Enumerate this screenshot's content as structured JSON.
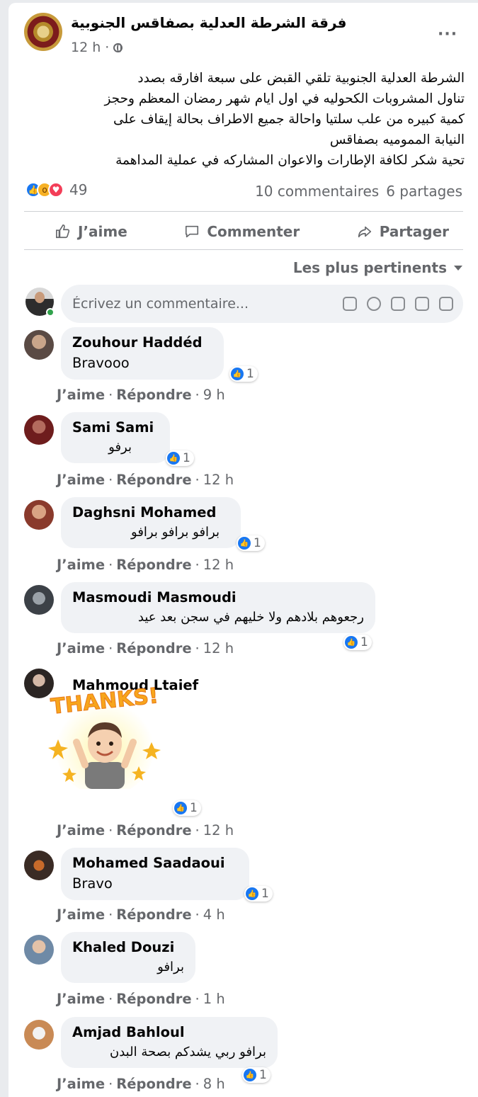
{
  "post": {
    "page_name": "فرقة الشرطة العدلية بصفاقس الجنوبية",
    "time": "12 h ·",
    "more_label": "···",
    "text_lines": [
      "الشرطة العدلية الجنوبية تلقي القبض على سبعة افارقه بصدد",
      "تناول المشروبات الكحوليه في اول ايام شهر رمضان المعظم وحجز",
      "كمية كبيره من علب سلتيا واحالة جميع الاطراف بحالة إيقاف على",
      "النيابة المموميه بصفاقس",
      "تحية شكر لكافة الإطارات والاعوان المشاركه في عملية المداهمة"
    ],
    "reaction_count": "49",
    "comments_count": "10 commentaires",
    "shares_count": "6 partages"
  },
  "actions": {
    "like": "J’aime",
    "comment": "Commenter",
    "share": "Partager"
  },
  "sort_label": "Les plus pertinents",
  "composer": {
    "placeholder": "Écrivez un commentaire..."
  },
  "comment_actions": {
    "like": "J’aime",
    "reply": "Répondre",
    "sep": "·"
  },
  "comments": [
    {
      "name": "Zouhour Haddéd",
      "text": "Bravooo",
      "reactions": "1",
      "age": "9 h"
    },
    {
      "name": "Sami Sami",
      "text": "برفو",
      "reactions": "1",
      "age": "12 h"
    },
    {
      "name": "Daghsni Mohamed",
      "text": "برافو برافو برافو",
      "reactions": "1",
      "age": "12 h"
    },
    {
      "name": "Masmoudi Masmoudi",
      "text": "رجعوهم بلادهم ولا خليهم في سجن بعد عيد",
      "reactions": "1",
      "age": "12 h"
    },
    {
      "name": "Mahmoud Ltaief",
      "sticker_text": "THANKS!",
      "reactions": "1",
      "age": "12 h"
    },
    {
      "name": "Mohamed Saadaoui",
      "text": "Bravo",
      "reactions": "1",
      "age": "4 h"
    },
    {
      "name": "Khaled Douzi",
      "text": "برافو",
      "age": "1 h"
    },
    {
      "name": "Amjad Bahloul",
      "text": "برافو ربي يشدكم بصحة البدن",
      "reactions": "1",
      "age": "8 h"
    }
  ],
  "colors": {
    "accent": "#1877f2",
    "muted": "#65676b",
    "bubble": "#f0f2f5"
  }
}
